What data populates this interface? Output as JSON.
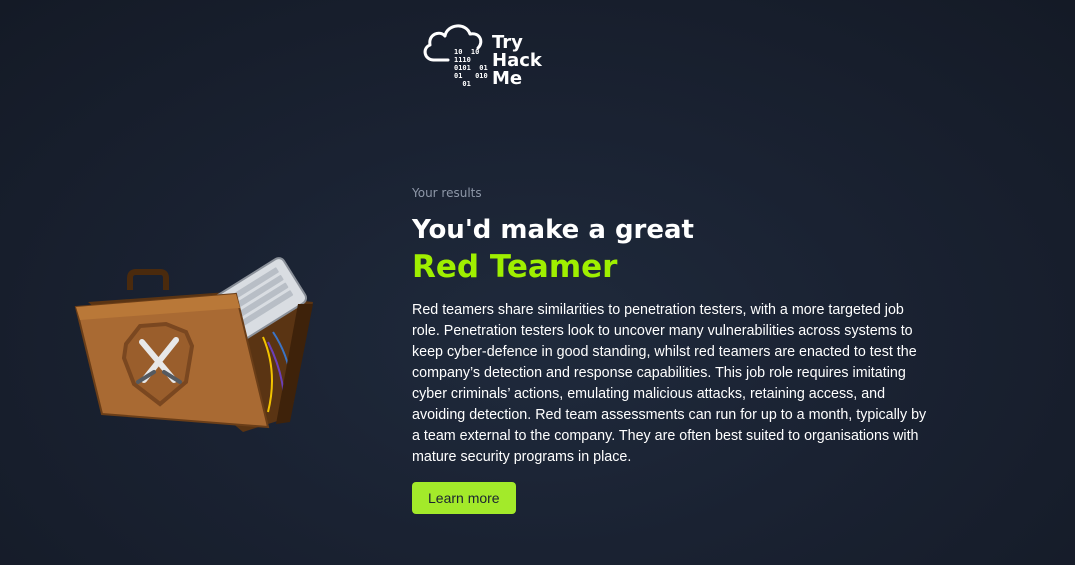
{
  "logo": {
    "bits": "10  10\n1110\n0101  01\n01   010\n  01",
    "line1": "Try",
    "line2": "Hack",
    "line3": "Me"
  },
  "results": {
    "kicker": "Your results",
    "headline": "You'd make a great",
    "role": "Red Teamer",
    "description": "Red teamers share similarities to penetration testers, with a more targeted job role. Penetration testers look to uncover many vulnerabilities across systems to keep cyber-defence in good standing, whilst red teamers are enacted to test the company’s detection and response capabilities. This job role requires imitating cyber criminals’ actions, emulating malicious attacks, retaining access, and avoiding detection. Red team assessments can run for up to a month, typically by a team external to the company. They are often best suited to organisations with mature security programs in place.",
    "cta_label": "Learn more"
  },
  "colors": {
    "accent": "#9fef00",
    "button_bg": "#a3ea2a",
    "background": "#1a2232"
  },
  "illustration": {
    "icon": "folder-with-keyboard-and-crossed-swords-icon"
  }
}
